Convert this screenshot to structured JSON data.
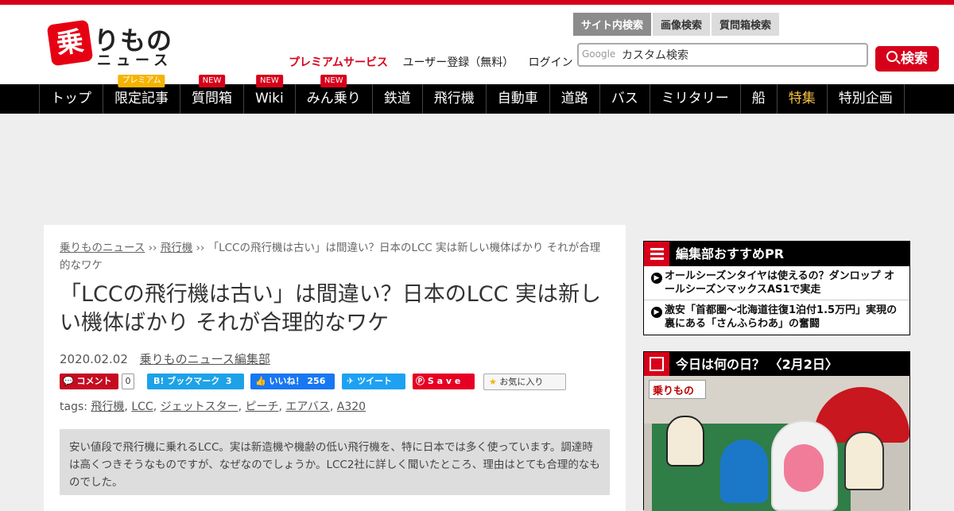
{
  "header": {
    "premium_link": "プレミアムサービス",
    "register_link": "ユーザー登録（無料）",
    "login_link": "ログイン",
    "logo_main": "りもの",
    "logo_mark": "乗",
    "logo_sub": "ニュース"
  },
  "search": {
    "tabs": [
      "サイト内検索",
      "画像検索",
      "質問箱検索"
    ],
    "google_label": "Google",
    "placeholder": "カスタム検索",
    "button": "検索"
  },
  "nav": {
    "items": [
      {
        "label": "トップ"
      },
      {
        "label": "限定記事",
        "badge": "プレミアム"
      },
      {
        "label": "質問箱",
        "badge": "NEW"
      },
      {
        "label": "Wiki",
        "badge": "NEW"
      },
      {
        "label": "みん乗り",
        "badge": "NEW"
      },
      {
        "label": "鉄道"
      },
      {
        "label": "飛行機"
      },
      {
        "label": "自動車"
      },
      {
        "label": "道路"
      },
      {
        "label": "バス"
      },
      {
        "label": "ミリタリー"
      },
      {
        "label": "船"
      },
      {
        "label": "特集"
      },
      {
        "label": "特別企画"
      }
    ]
  },
  "article": {
    "breadcrumb": {
      "home": "乗りものニュース",
      "category": "飛行機",
      "sep": " ›› ",
      "current": "「LCCの飛行機は古い」は間違い？日本のLCC 実は新しい機体ばかり それが合理的なワケ"
    },
    "title": "「LCCの飛行機は古い」は間違い？日本のLCC 実は新しい機体ばかり それが合理的なワケ",
    "date": "2020.02.02",
    "author": "乗りものニュース編集部",
    "share": {
      "comment": "コメント",
      "comment_count": "0",
      "hatena": "B! ブックマーク",
      "hatena_count": "3",
      "fb": "いいね！",
      "fb_count": "256",
      "tweet": "ツイート",
      "save": "S a v e",
      "fav": "お気に入り"
    },
    "tags_label": "tags:",
    "tags": [
      "飛行機",
      "LCC",
      "ジェットスター",
      "ピーチ",
      "エアバス",
      "A320"
    ],
    "lead": "安い値段で飛行機に乗れるLCC。実は新造機や機齢の低い飛行機を、特に日本では多く使っています。調達時は高くつきそうなものですが、なぜなのでしょうか。LCC2社に詳しく聞いたところ、理由はとても合理的なものでした。"
  },
  "sidebar": {
    "pr_title": "編集部おすすめPR",
    "pr_items": [
      "オールシーズンタイヤは使えるの？ダンロップ オールシーズンマックスAS1で実走",
      "激安「首都圏～北海道往復1泊付1.5万円」実現の裏にある「さんふらわあ」の奮闘"
    ],
    "today_title": "今日は何の日？ 〈2月2日〉",
    "photo_sign": "乗りもの"
  },
  "colors": {
    "brand_red": "#d7001a",
    "nav_bg": "#000000",
    "special_nav": "#f5c242"
  }
}
